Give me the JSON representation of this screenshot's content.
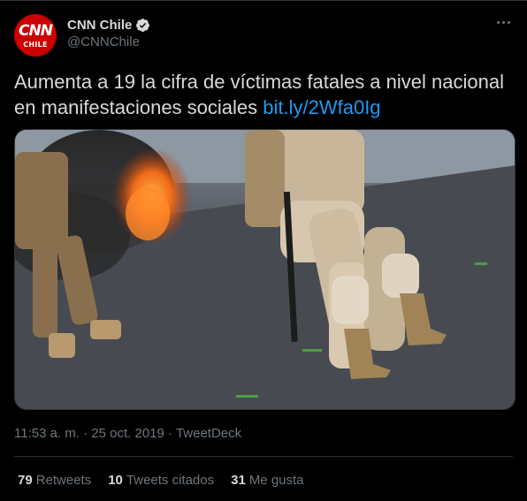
{
  "author": {
    "display_name": "CNN Chile",
    "handle": "@CNNChile",
    "avatar_logo": "CNN",
    "avatar_sub": "CHILE",
    "verified": true,
    "verified_color": "#d9d9d9"
  },
  "tweet": {
    "text": "Aumenta a 19 la cifra de víctimas fatales a nivel nacional en manifestaciones sociales ",
    "link": "bit.ly/2Wfa0Ig",
    "link_color": "#1d9bf0"
  },
  "media": {
    "description_icon": "photo-soldiers-street"
  },
  "meta": {
    "time": "11:53 a. m.",
    "separator1": "·",
    "date": "25 oct. 2019",
    "separator2": "·",
    "source": "TweetDeck"
  },
  "stats": [
    {
      "count": "79",
      "label": "Retweets"
    },
    {
      "count": "10",
      "label": "Tweets citados"
    },
    {
      "count": "31",
      "label": "Me gusta"
    }
  ],
  "colors": {
    "background": "#000000",
    "text": "#d9d9d9",
    "secondary": "#6e767d",
    "brand_red": "#cc0000",
    "divider": "#2f3336"
  }
}
